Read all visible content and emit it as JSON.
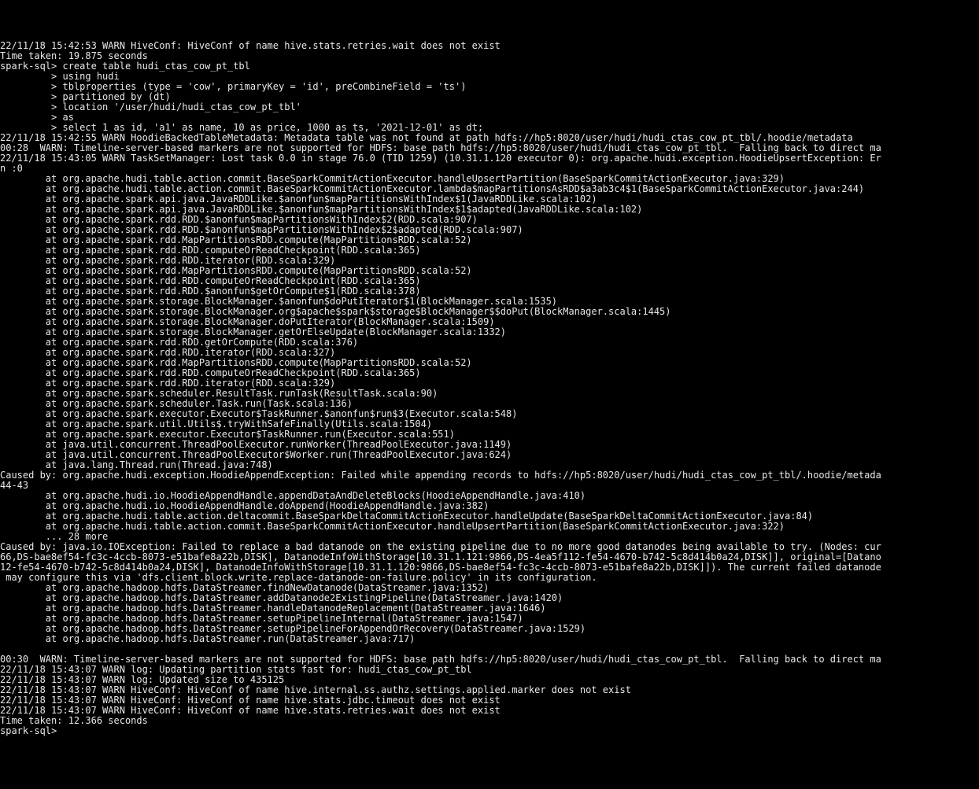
{
  "lines": [
    "22/11/18 15:42:53 WARN HiveConf: HiveConf of name hive.stats.retries.wait does not exist",
    "Time taken: 19.875 seconds",
    "spark-sql> create table hudi_ctas_cow_pt_tbl",
    "         > using hudi",
    "         > tblproperties (type = 'cow', primaryKey = 'id', preCombineField = 'ts')",
    "         > partitioned by (dt)",
    "         > location '/user/hudi/hudi_ctas_cow_pt_tbl'",
    "         > as",
    "         > select 1 as id, 'a1' as name, 10 as price, 1000 as ts, '2021-12-01' as dt;",
    "22/11/18 15:42:55 WARN HoodieBackedTableMetadata: Metadata table was not found at path hdfs://hp5:8020/user/hudi/hudi_ctas_cow_pt_tbl/.hoodie/metadata",
    "00:28  WARN: Timeline-server-based markers are not supported for HDFS: base path hdfs://hp5:8020/user/hudi/hudi_ctas_cow_pt_tbl.  Falling back to direct ma",
    "22/11/18 15:43:05 WARN TaskSetManager: Lost task 0.0 in stage 76.0 (TID 1259) (10.31.1.120 executor 0): org.apache.hudi.exception.HoodieUpsertException: Er",
    "n :0",
    "        at org.apache.hudi.table.action.commit.BaseSparkCommitActionExecutor.handleUpsertPartition(BaseSparkCommitActionExecutor.java:329)",
    "        at org.apache.hudi.table.action.commit.BaseSparkCommitActionExecutor.lambda$mapPartitionsAsRDD$a3ab3c4$1(BaseSparkCommitActionExecutor.java:244)",
    "        at org.apache.spark.api.java.JavaRDDLike.$anonfun$mapPartitionsWithIndex$1(JavaRDDLike.scala:102)",
    "        at org.apache.spark.api.java.JavaRDDLike.$anonfun$mapPartitionsWithIndex$1$adapted(JavaRDDLike.scala:102)",
    "        at org.apache.spark.rdd.RDD.$anonfun$mapPartitionsWithIndex$2(RDD.scala:907)",
    "        at org.apache.spark.rdd.RDD.$anonfun$mapPartitionsWithIndex$2$adapted(RDD.scala:907)",
    "        at org.apache.spark.rdd.MapPartitionsRDD.compute(MapPartitionsRDD.scala:52)",
    "        at org.apache.spark.rdd.RDD.computeOrReadCheckpoint(RDD.scala:365)",
    "        at org.apache.spark.rdd.RDD.iterator(RDD.scala:329)",
    "        at org.apache.spark.rdd.MapPartitionsRDD.compute(MapPartitionsRDD.scala:52)",
    "        at org.apache.spark.rdd.RDD.computeOrReadCheckpoint(RDD.scala:365)",
    "        at org.apache.spark.rdd.RDD.$anonfun$getOrCompute$1(RDD.scala:378)",
    "        at org.apache.spark.storage.BlockManager.$anonfun$doPutIterator$1(BlockManager.scala:1535)",
    "        at org.apache.spark.storage.BlockManager.org$apache$spark$storage$BlockManager$$doPut(BlockManager.scala:1445)",
    "        at org.apache.spark.storage.BlockManager.doPutIterator(BlockManager.scala:1509)",
    "        at org.apache.spark.storage.BlockManager.getOrElseUpdate(BlockManager.scala:1332)",
    "        at org.apache.spark.rdd.RDD.getOrCompute(RDD.scala:376)",
    "        at org.apache.spark.rdd.RDD.iterator(RDD.scala:327)",
    "        at org.apache.spark.rdd.MapPartitionsRDD.compute(MapPartitionsRDD.scala:52)",
    "        at org.apache.spark.rdd.RDD.computeOrReadCheckpoint(RDD.scala:365)",
    "        at org.apache.spark.rdd.RDD.iterator(RDD.scala:329)",
    "        at org.apache.spark.scheduler.ResultTask.runTask(ResultTask.scala:90)",
    "        at org.apache.spark.scheduler.Task.run(Task.scala:136)",
    "        at org.apache.spark.executor.Executor$TaskRunner.$anonfun$run$3(Executor.scala:548)",
    "        at org.apache.spark.util.Utils$.tryWithSafeFinally(Utils.scala:1504)",
    "        at org.apache.spark.executor.Executor$TaskRunner.run(Executor.scala:551)",
    "        at java.util.concurrent.ThreadPoolExecutor.runWorker(ThreadPoolExecutor.java:1149)",
    "        at java.util.concurrent.ThreadPoolExecutor$Worker.run(ThreadPoolExecutor.java:624)",
    "        at java.lang.Thread.run(Thread.java:748)",
    "Caused by: org.apache.hudi.exception.HoodieAppendException: Failed while appending records to hdfs://hp5:8020/user/hudi/hudi_ctas_cow_pt_tbl/.hoodie/metada",
    "44-43",
    "        at org.apache.hudi.io.HoodieAppendHandle.appendDataAndDeleteBlocks(HoodieAppendHandle.java:410)",
    "        at org.apache.hudi.io.HoodieAppendHandle.doAppend(HoodieAppendHandle.java:382)",
    "        at org.apache.hudi.table.action.deltacommit.BaseSparkDeltaCommitActionExecutor.handleUpdate(BaseSparkDeltaCommitActionExecutor.java:84)",
    "        at org.apache.hudi.table.action.commit.BaseSparkCommitActionExecutor.handleUpsertPartition(BaseSparkCommitActionExecutor.java:322)",
    "        ... 28 more",
    "Caused by: java.io.IOException: Failed to replace a bad datanode on the existing pipeline due to no more good datanodes being available to try. (Nodes: cur",
    "66,DS-bae8ef54-fc3c-4ccb-8073-e51bafe8a22b,DISK], DatanodeInfoWithStorage[10.31.1.121:9866,DS-4ea5f112-fe54-4670-b742-5c8d414b0a24,DISK]], original=[Datano",
    "12-fe54-4670-b742-5c8d414b0a24,DISK], DatanodeInfoWithStorage[10.31.1.120:9866,DS-bae8ef54-fc3c-4ccb-8073-e51bafe8a22b,DISK]]). The current failed datanode",
    " may configure this via 'dfs.client.block.write.replace-datanode-on-failure.policy' in its configuration.",
    "        at org.apache.hadoop.hdfs.DataStreamer.findNewDatanode(DataStreamer.java:1352)",
    "        at org.apache.hadoop.hdfs.DataStreamer.addDatanode2ExistingPipeline(DataStreamer.java:1420)",
    "        at org.apache.hadoop.hdfs.DataStreamer.handleDatanodeReplacement(DataStreamer.java:1646)",
    "        at org.apache.hadoop.hdfs.DataStreamer.setupPipelineInternal(DataStreamer.java:1547)",
    "        at org.apache.hadoop.hdfs.DataStreamer.setupPipelineForAppendOrRecovery(DataStreamer.java:1529)",
    "        at org.apache.hadoop.hdfs.DataStreamer.run(DataStreamer.java:717)",
    "",
    "00:30  WARN: Timeline-server-based markers are not supported for HDFS: base path hdfs://hp5:8020/user/hudi/hudi_ctas_cow_pt_tbl.  Falling back to direct ma",
    "22/11/18 15:43:07 WARN log: Updating partition stats fast for: hudi_ctas_cow_pt_tbl",
    "22/11/18 15:43:07 WARN log: Updated size to 435125",
    "22/11/18 15:43:07 WARN HiveConf: HiveConf of name hive.internal.ss.authz.settings.applied.marker does not exist",
    "22/11/18 15:43:07 WARN HiveConf: HiveConf of name hive.stats.jdbc.timeout does not exist",
    "22/11/18 15:43:07 WARN HiveConf: HiveConf of name hive.stats.retries.wait does not exist",
    "Time taken: 12.366 seconds",
    "spark-sql>"
  ]
}
